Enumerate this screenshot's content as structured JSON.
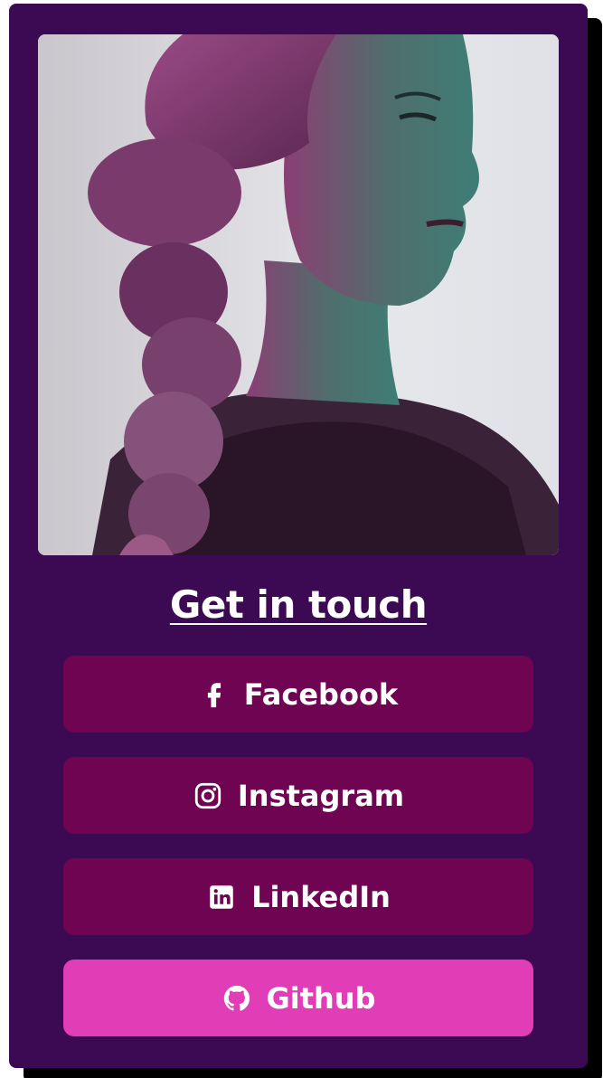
{
  "card": {
    "heading": "Get in touch",
    "photo_alt": "Portrait of a woman with braided hair"
  },
  "links": [
    {
      "label": "Facebook",
      "icon": "facebook-icon",
      "color": "#6e0452"
    },
    {
      "label": "Instagram",
      "icon": "instagram-icon",
      "color": "#6e0452"
    },
    {
      "label": "LinkedIn",
      "icon": "linkedin-icon",
      "color": "#6e0452"
    },
    {
      "label": "Github",
      "icon": "github-icon",
      "color": "#e03db7"
    }
  ],
  "colors": {
    "card_background": "#3b0a52",
    "button": "#6e0452",
    "button_active": "#e03db7",
    "text": "#ffffff",
    "shadow": "#000000"
  }
}
